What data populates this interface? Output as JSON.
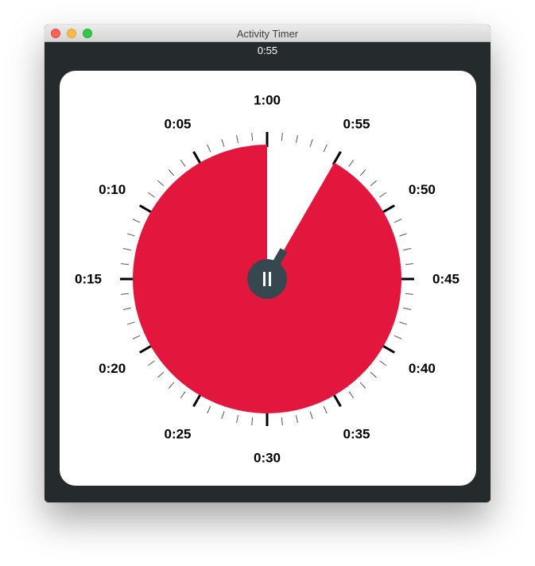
{
  "window": {
    "title": "Activity Timer"
  },
  "status": {
    "remaining": "0:55"
  },
  "dial": {
    "labels": [
      "1:00",
      "0:55",
      "0:50",
      "0:45",
      "0:40",
      "0:35",
      "0:30",
      "0:25",
      "0:20",
      "0:15",
      "0:10",
      "0:05"
    ],
    "total_minutes": 60,
    "remaining_minutes": 55,
    "fill_color": "#e3173d",
    "hub_color": "#37474f",
    "hub_icon": "pause-icon"
  }
}
